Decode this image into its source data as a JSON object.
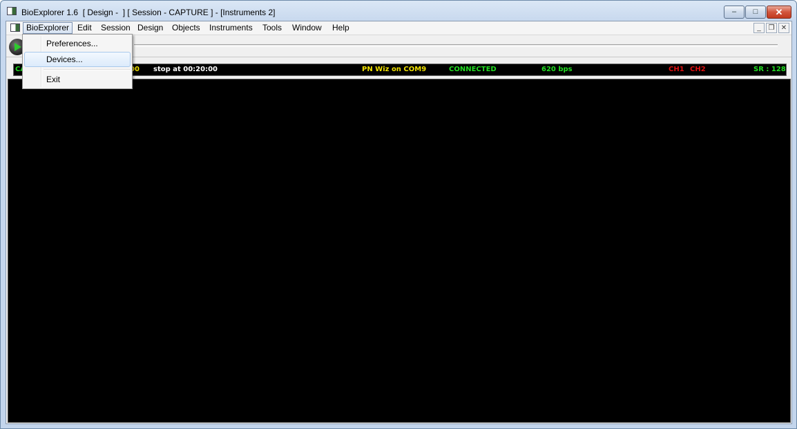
{
  "window": {
    "title": "BioExplorer 1.6  [ Design -  ] [ Session - CAPTURE ] - [Instruments 2]",
    "controls": {
      "minimize": "–",
      "maximize": "□",
      "close": "✕"
    }
  },
  "menubar": {
    "items": [
      "BioExplorer",
      "Edit",
      "Session",
      "Design",
      "Objects",
      "Instruments",
      "Tools",
      "Window",
      "Help"
    ],
    "active": "BioExplorer",
    "mdi_controls": {
      "minimize": "_",
      "restore": "❐",
      "close": "✕"
    }
  },
  "dropdown": {
    "items": [
      "Preferences...",
      "Devices...",
      "Exit"
    ],
    "highlighted": "Devices..."
  },
  "statusbar": {
    "left_fragment": "CA",
    "time_fragment": "00",
    "stop_at": "stop at 00:20:00",
    "device": "PN Wiz on COM9",
    "connection": "CONNECTED",
    "rate": "620 bps",
    "ch1": "CH1",
    "ch2": "CH2",
    "sample_rate": "SR : 128"
  },
  "colors": {
    "status_green": "#22dd22",
    "status_yellow": "#f0e000",
    "status_red": "#e01010",
    "status_white": "#ffffff"
  }
}
